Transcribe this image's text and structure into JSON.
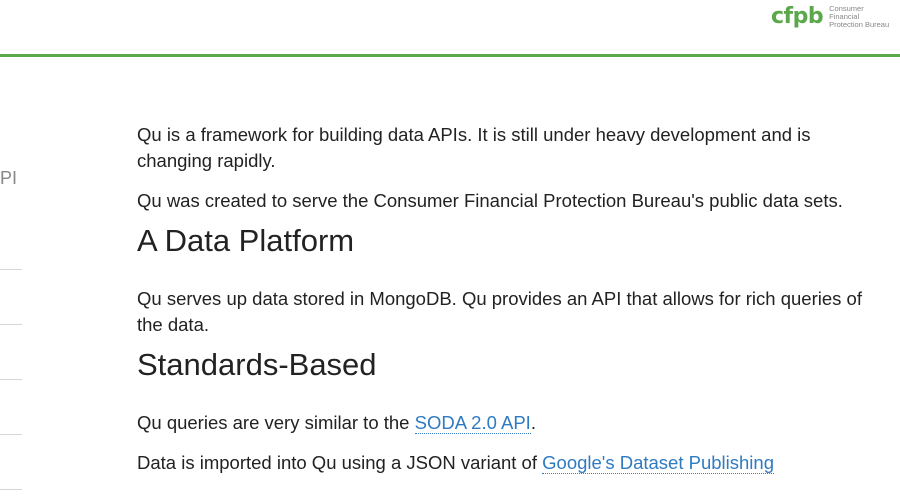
{
  "brand": {
    "mark": "cfpb",
    "name_line1": "Consumer Financial",
    "name_line2": "Protection Bureau",
    "accent_color": "#5aa84a",
    "link_color": "#2f7bc1"
  },
  "sidebar": {
    "fragment_text": "PI"
  },
  "content": {
    "intro1": "Qu is a framework for building data APIs. It is still under heavy development and is changing rapidly.",
    "intro2": "Qu was created to serve the Consumer Financial Protection Bureau's public data sets.",
    "section1_heading": "A Data Platform",
    "section1_text": "Qu serves up data stored in MongoDB. Qu provides an API that allows for rich queries of the data.",
    "section2_heading": "Standards-Based",
    "soda_prefix": "Qu queries are very similar to the ",
    "soda_link": "SODA 2.0 API",
    "soda_suffix": ".",
    "dspl_prefix": "Data is imported into Qu using a JSON variant of ",
    "dspl_link": "Google's Dataset Publishing"
  }
}
